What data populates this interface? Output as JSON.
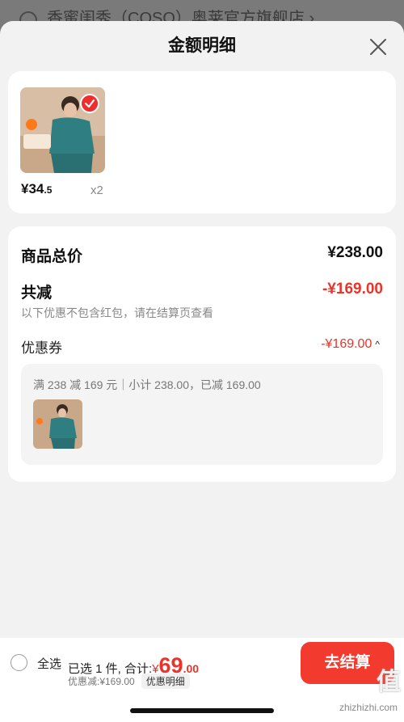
{
  "background": {
    "store_name": "香蜜闺秀（COSO）奥莱官方旗舰店 ›"
  },
  "sheet": {
    "title": "金额明细"
  },
  "product": {
    "price_int": "¥34",
    "price_dec": ".5",
    "quantity": "x2"
  },
  "breakdown": {
    "total_label": "商品总价",
    "total_value": "¥238.00",
    "reduce_label": "共减",
    "reduce_value": "-¥169.00",
    "note": "以下优惠不包含红包，请在结算页查看",
    "coupon_label": "优惠券",
    "coupon_value": "-¥169.00",
    "coupon_desc": "满 238 减 169 元｜小计 238.00，已减 169.00"
  },
  "bottom_bar": {
    "select_all": "全选",
    "summary_prefix": "已选 1 件, 合计:",
    "summary_yen": "¥",
    "summary_int": "69",
    "summary_dec": ".00",
    "discount": "优惠减:¥169.00",
    "detail_button": "优惠明细",
    "checkout_button": "去结算"
  },
  "watermark": {
    "text": "值",
    "url": "zhizhizhi.com"
  },
  "colors": {
    "accent_red": "#e8342a",
    "checkout_red": "#f23a2e"
  },
  "icons": [
    "close-icon",
    "check-badge-icon",
    "chevron-up-icon"
  ]
}
